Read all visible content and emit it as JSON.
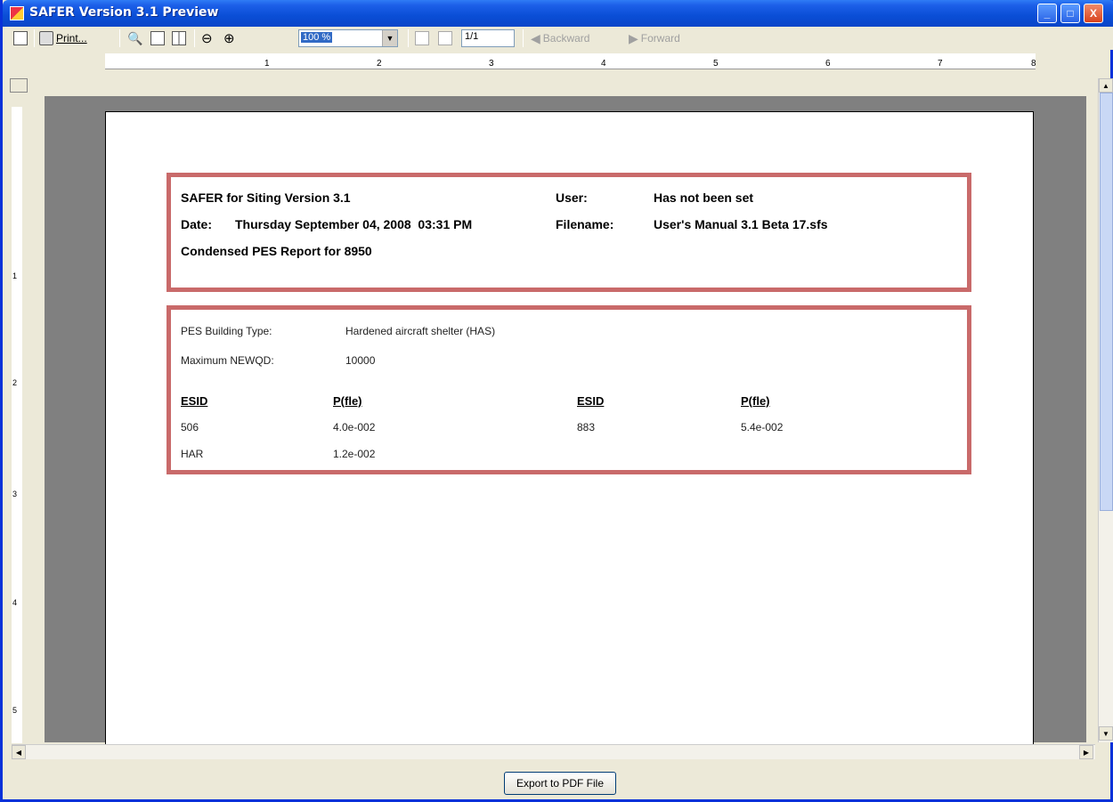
{
  "window": {
    "title": "SAFER Version 3.1 Preview",
    "minimize": "_",
    "maximize": "□",
    "close": "X"
  },
  "toolbar": {
    "print_label": "Print...",
    "zoom_value": "100 %",
    "page_value": "1/1",
    "backward_label": "Backward",
    "forward_label": "Forward"
  },
  "ruler": {
    "h_ticks": [
      "1",
      "2",
      "3",
      "4",
      "5",
      "6",
      "7",
      "8"
    ],
    "v_ticks": [
      "1",
      "2",
      "3",
      "4",
      "5"
    ]
  },
  "report": {
    "header": {
      "app_title": "SAFER for Siting Version 3.1",
      "user_label": "User:",
      "user_value": "Has not been set",
      "date_label": "Date:",
      "date_value": "Thursday September 04, 2008  03:31 PM",
      "filename_label": "Filename:",
      "filename_value": "User's Manual 3.1 Beta 17.sfs",
      "report_title": "Condensed PES Report for 8950"
    },
    "details": {
      "building_type_label": "PES Building Type:",
      "building_type_value": "Hardened aircraft shelter (HAS)",
      "max_newqd_label": "Maximum NEWQD:",
      "max_newqd_value": "10000",
      "col_esid_1": "ESID",
      "col_pfle_1": "P(fle)",
      "col_esid_2": "ESID",
      "col_pfle_2": "P(fle)",
      "rows": [
        {
          "esid1": "506",
          "pfle1": "4.0e-002",
          "esid2": "883",
          "pfle2": "5.4e-002"
        },
        {
          "esid1": "HAR",
          "pfle1": "1.2e-002",
          "esid2": "",
          "pfle2": ""
        }
      ]
    }
  },
  "footer": {
    "export_label": "Export to PDF File"
  }
}
